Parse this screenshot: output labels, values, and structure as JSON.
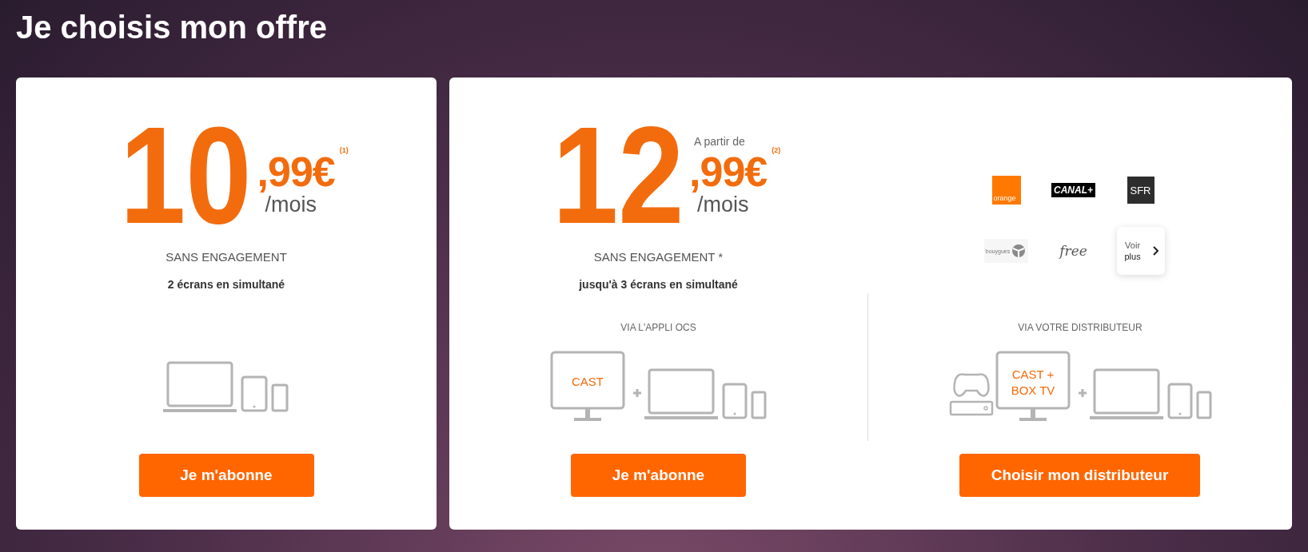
{
  "title": "Je choisis mon offre",
  "offers": [
    {
      "columns": [
        {
          "kind": "price",
          "price": {
            "whole": "10",
            "cents": ",99€",
            "note": "(1)",
            "period": "/mois"
          },
          "engagement": "SANS ENGAGEMENT",
          "screens": "2 écrans en simultané",
          "illustration": {
            "kind": "devices"
          },
          "button": "Je m'abonne"
        }
      ]
    },
    {
      "columns": [
        {
          "kind": "price",
          "price": {
            "prefix": "A partir de",
            "whole": "12",
            "cents": ",99€",
            "note": "(2)",
            "period": "/mois"
          },
          "engagement": "SANS ENGAGEMENT *",
          "screens": "jusqu'à 3 écrans en simultané",
          "label": "VIA L'APPLI OCS",
          "illustration": {
            "kind": "app",
            "screen_lines": [
              "CAST"
            ]
          },
          "button": "Je m'abonne"
        },
        {
          "kind": "distributors",
          "divided": true,
          "distributors": [
            {
              "kind": "orange",
              "name": "orange"
            },
            {
              "kind": "canal",
              "name": "CANAL+"
            },
            {
              "kind": "sfr",
              "name": "SFR"
            },
            {
              "kind": "bouygues",
              "name": "bouygues"
            },
            {
              "kind": "free",
              "name": "free"
            }
          ],
          "more": [
            "Voir",
            "plus"
          ],
          "label": "VIA VOTRE DISTRIBUTEUR",
          "illustration": {
            "kind": "box",
            "screen_lines": [
              "CAST +",
              "BOX TV"
            ]
          },
          "button": "Choisir mon distributeur"
        }
      ]
    }
  ]
}
